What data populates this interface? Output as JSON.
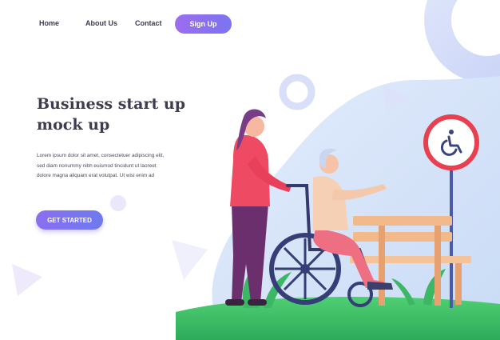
{
  "nav": {
    "home": "Home",
    "about": "About Us",
    "contact": "Contact",
    "signup": "Sign Up"
  },
  "hero": {
    "title_line1": "Business start up",
    "title_line2": "mock up",
    "body_line1": "Lorem ipsum dolor sit amet, consectetuer adipiscing elit,",
    "body_line2": "sed diam nonummy nibh euismod tincidunt ut laoreet",
    "body_line3": "dolore magna aliquam erat volutpat. Ut wisi enim ad",
    "cta": "GET STARTED"
  },
  "icons": {
    "sign": "wheelchair-sign-icon"
  },
  "colors": {
    "accent": "#8b6ff0",
    "sign_ring": "#e8404f",
    "grass": "#3fbf66"
  }
}
